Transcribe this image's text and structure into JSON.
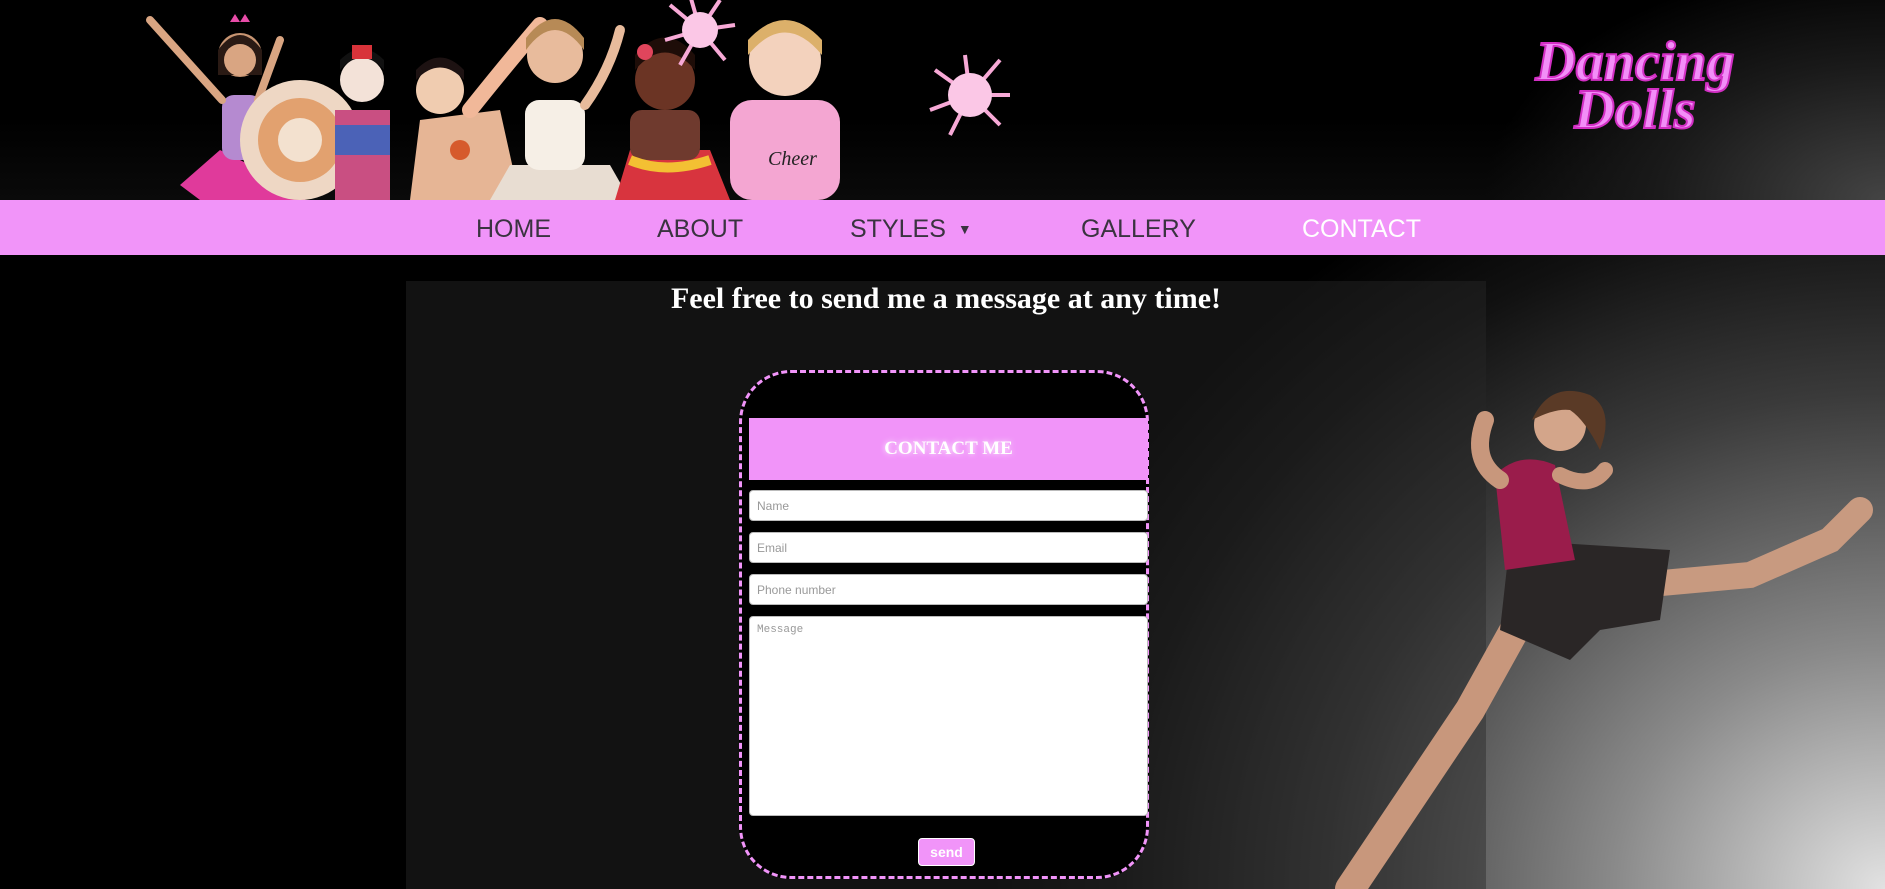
{
  "header": {
    "logo": {
      "line1": "Dancing",
      "line2": "Dolls"
    },
    "banner_image": "dolls-banner"
  },
  "nav": {
    "items": [
      {
        "label": "HOME",
        "active": false
      },
      {
        "label": "ABOUT",
        "active": false
      },
      {
        "label": "STYLES",
        "active": false,
        "has_dropdown": true,
        "caret": "▼"
      },
      {
        "label": "GALLERY",
        "active": false
      },
      {
        "label": "CONTACT",
        "active": true
      }
    ]
  },
  "main": {
    "headline": "Feel free to send me a message at any time!",
    "form": {
      "title": "CONTACT ME",
      "name": {
        "value": "",
        "placeholder": "Name"
      },
      "email": {
        "value": "",
        "placeholder": "Email"
      },
      "phone": {
        "value": "",
        "placeholder": "Phone number"
      },
      "message": {
        "value": "",
        "placeholder": "Message"
      },
      "send_label": "send"
    }
  },
  "colors": {
    "accent_pink": "#f194f9",
    "nav_text": "#3a3340",
    "background": "#000000"
  }
}
